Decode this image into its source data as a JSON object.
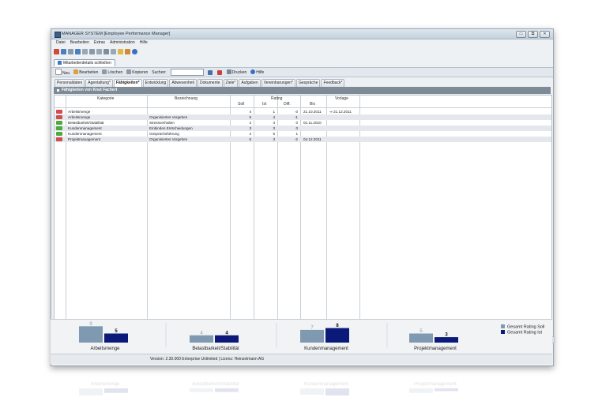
{
  "window": {
    "title": "MANAGER SYSTEM [Employee Performance Manager]",
    "minimize": "▭",
    "restore": "⧉",
    "close": "✕"
  },
  "menu": [
    "Datei",
    "Bearbeiten",
    "Extras",
    "Administration",
    "Hilfe"
  ],
  "doc_tab": {
    "label": "Mitarbeiterdetails schließen"
  },
  "cmd": {
    "neu": "Neu",
    "bearbeiten": "Bearbeiten",
    "loeschen": "Löschen",
    "kopieren": "Kopieren",
    "suchen_label": "Suchen:",
    "search_value": "",
    "drucken": "Drucken",
    "hilfe": "Hilfe"
  },
  "subtabs": [
    "Personaldaten",
    "Agentaltung*",
    "Fähigkeiten*",
    "Entwicklung",
    "Abwesenheit",
    "Dokumente",
    "Ziele*",
    "Aufgaben",
    "Vereinbarungen*",
    "Gespräche",
    "Feedback*"
  ],
  "section_title": "Fähigkeiten von Knut Fachert",
  "table": {
    "headers": {
      "kategorie": "Kategorie",
      "bezeichnung": "Bezeichnung",
      "rating": "Rating",
      "vorlage": "Vorlage",
      "soll": "Soll",
      "ist": "Ist",
      "diff": "Diff.",
      "bis": "Bis"
    },
    "rows": [
      {
        "ind": "minus",
        "kategorie": "Arbeitsmenge",
        "bezeichnung": "",
        "soll": "4",
        "ist": "1",
        "diff": "-3",
        "bis": "21.10.2011",
        "vorlage": "⇒  21.12.2011"
      },
      {
        "ind": "minus",
        "kategorie": "Arbeitsmenge",
        "bezeichnung": "Organisiertes Vorgehen",
        "soll": "5",
        "ist": "4",
        "diff": "-1",
        "bis": "",
        "vorlage": ""
      },
      {
        "ind": "plus",
        "kategorie": "Belastbarkeit/Stabilität",
        "bezeichnung": "Stressverhalten",
        "soll": "4",
        "ist": "4",
        "diff": "0",
        "bis": "01.11.2010",
        "vorlage": ""
      },
      {
        "ind": "plus",
        "kategorie": "Kundenmanagement",
        "bezeichnung": "Einbinden Entscheidungen",
        "soll": "3",
        "ist": "3",
        "diff": "0",
        "bis": "",
        "vorlage": ""
      },
      {
        "ind": "plus",
        "kategorie": "Kundenmanagement",
        "bezeichnung": "Gesprächsführung",
        "soll": "4",
        "ist": "5",
        "diff": "1",
        "bis": "",
        "vorlage": ""
      },
      {
        "ind": "minus",
        "kategorie": "Projektmanagement",
        "bezeichnung": "Organisiertes Vorgehen",
        "soll": "5",
        "ist": "3",
        "diff": "-2",
        "bis": "04.12.2011",
        "vorlage": ""
      }
    ]
  },
  "navigator": "|◀  ◀◀  ◀  ▶  ▶▶  ▶|  ◀",
  "chart_data": {
    "type": "bar",
    "categories": [
      "Arbeitsmenge",
      "Belastbarkeit/Stabilität",
      "Kundenmanagement",
      "Projektmanagement"
    ],
    "series": [
      {
        "name": "Gesamt Rating Soll",
        "values": [
          9,
          4,
          7,
          5
        ],
        "color": "#7f9ab0"
      },
      {
        "name": "Gesamt Rating Ist",
        "values": [
          5,
          4,
          8,
          3
        ],
        "color": "#0b1a78"
      }
    ],
    "ylim": [
      0,
      10
    ]
  },
  "status": {
    "text": "Version: 2.30.000 Enterprise Unlimited  |  Lizenz: Heinzelmann AG"
  },
  "colors": {
    "accent": "#3d79c2",
    "section": "#7e8a96"
  }
}
